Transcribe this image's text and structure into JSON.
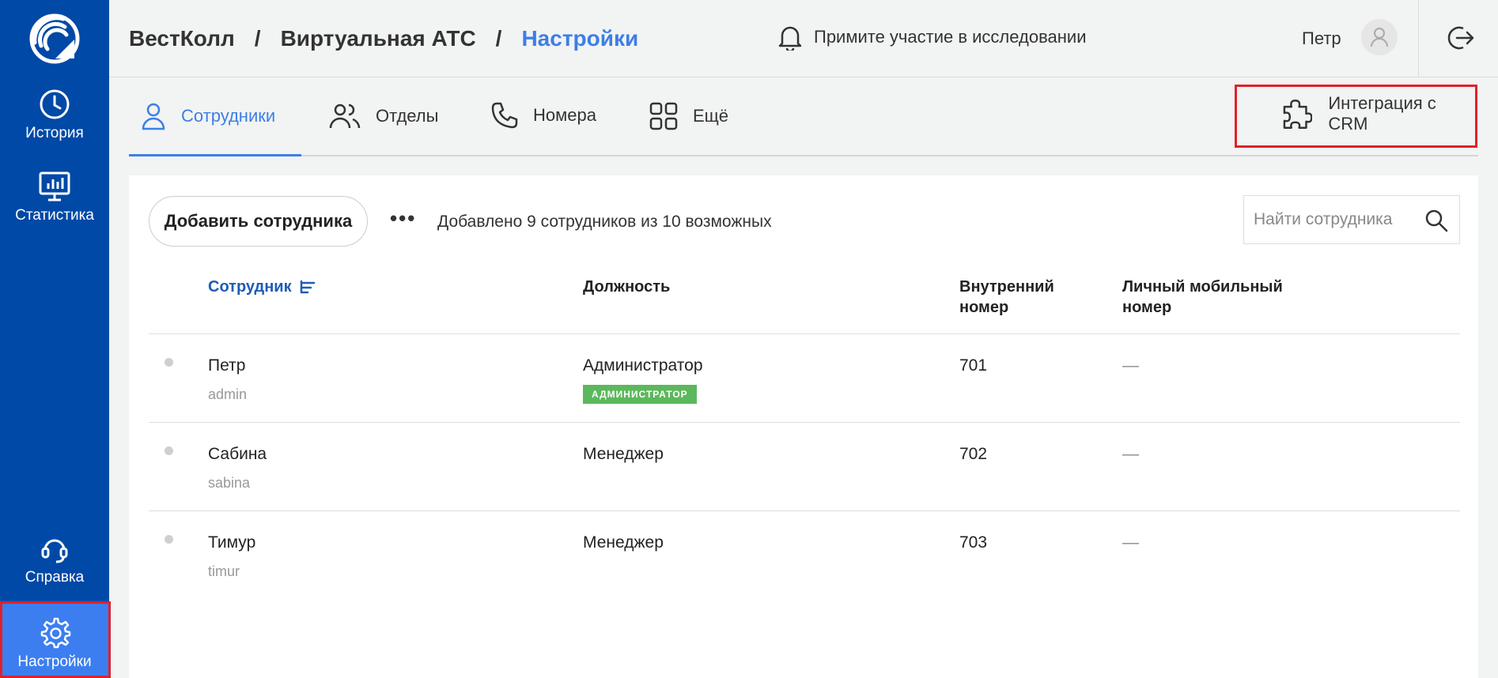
{
  "colors": {
    "sidebar": "#0049a7",
    "active_nav": "#3c7ef0",
    "accent": "#3d7fe6",
    "badge": "#5cb85c",
    "highlight": "#e0202a"
  },
  "sidebar": {
    "logo_icon": "wifi-logo-icon",
    "items": [
      {
        "label": "История",
        "icon": "clock-icon"
      },
      {
        "label": "Статистика",
        "icon": "monitor-chart-icon"
      },
      {
        "label": "Справка",
        "icon": "headset-icon"
      },
      {
        "label": "Настройки",
        "icon": "gear-icon",
        "active": true
      }
    ]
  },
  "header": {
    "breadcrumb": [
      "ВестКолл",
      "Виртуальная АТС",
      "Настройки"
    ],
    "separator": "/",
    "research": "Примите участие в исследовании",
    "user_name": "Петр"
  },
  "tabs": [
    {
      "label": "Сотрудники",
      "icon": "person-icon",
      "active": true
    },
    {
      "label": "Отделы",
      "icon": "people-icon"
    },
    {
      "label": "Номера",
      "icon": "phone-icon"
    },
    {
      "label": "Ещё",
      "icon": "grid-icon"
    }
  ],
  "crm_button": {
    "label": "Интеграция с CRM",
    "icon": "puzzle-icon"
  },
  "toolbar": {
    "add_label": "Добавить сотрудника",
    "more": "•••",
    "count_text": "Добавлено 9 сотрудников из 10 возможных",
    "search_placeholder": "Найти сотрудника"
  },
  "table": {
    "headers": {
      "employee": "Сотрудник",
      "position": "Должность",
      "internal": "Внутренний номер",
      "mobile": "Личный мобильный номер"
    },
    "rows": [
      {
        "name": "Петр",
        "login": "admin",
        "position": "Администратор",
        "badge": "АДМИНИСТРАТОР",
        "internal": "701",
        "mobile": "—"
      },
      {
        "name": "Сабина",
        "login": "sabina",
        "position": "Менеджер",
        "internal": "702",
        "mobile": "—"
      },
      {
        "name": "Тимур",
        "login": "timur",
        "position": "Менеджер",
        "internal": "703",
        "mobile": "—"
      }
    ]
  }
}
